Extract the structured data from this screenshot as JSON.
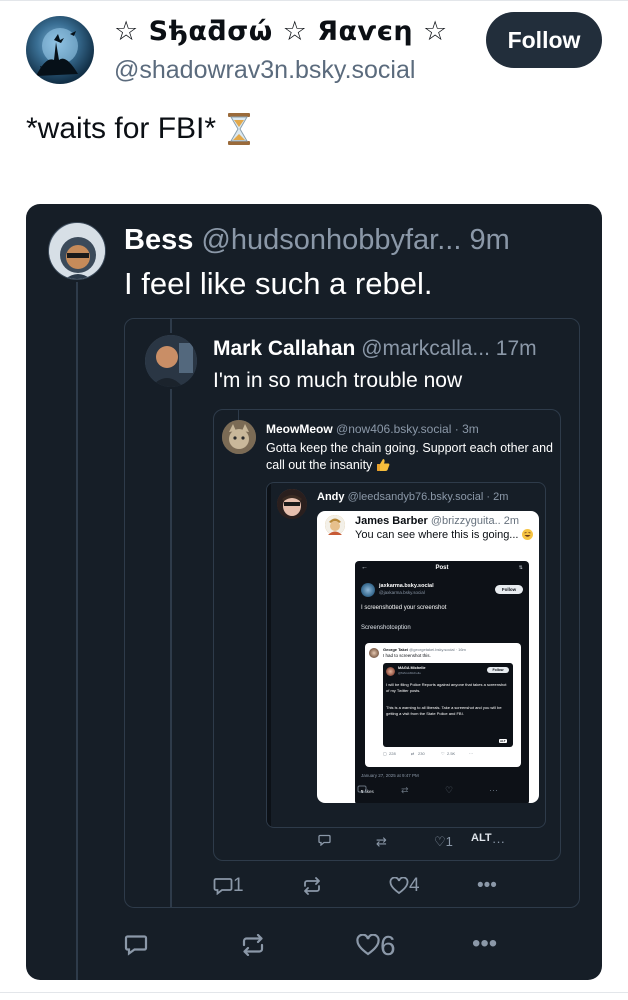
{
  "header": {
    "display_name": "☆ Sђαƌσώ ☆ Яαѵєη ☆",
    "handle": "@shadowrav3n.bsky.social",
    "follow_label": "Follow"
  },
  "post": {
    "text": "*waits for FBI*",
    "emoji": "hourglass-icon"
  },
  "quote1": {
    "name": "Bess",
    "handle": "@hudsonhobbyfar...",
    "time": "9m",
    "text": "I feel like such a rebel.",
    "replies": "",
    "likes": "6"
  },
  "quote2": {
    "name": "Mark Callahan",
    "handle": "@markcalla...",
    "time": "17m",
    "text": "I'm in so much trouble now",
    "replies": "1",
    "likes": "4"
  },
  "quote3": {
    "name": "MeowMeow",
    "handle": "@now406.bsky.social",
    "time": "3m",
    "text": "Gotta keep the chain going. Support each other and call out the insanity",
    "likes": "1",
    "alt": "ALT"
  },
  "quote4": {
    "name": "Andy",
    "handle": "@leedsandyb76.bsky.social",
    "time": "2m"
  },
  "quote5": {
    "name": "James Barber",
    "handle": "@brizzyguita..",
    "time": "2m",
    "text": "You can see where this is going..."
  },
  "screenshot": {
    "title": "Post",
    "name": "jaxkarma.bsky.social",
    "handle": "@jaxkarma.bsky.social",
    "follow": "Follow",
    "text1": "I screenshotted your screenshot",
    "text2": "Screenshotception",
    "date": "January 27, 2025 at 9:47 PM",
    "likes_count": "5",
    "likes_label": "likes"
  },
  "george": {
    "name": "George Takei",
    "handle": "@georgetakei.bsky.social",
    "time": "16m",
    "text": "I had to screenshot this.",
    "replies": "228",
    "reposts": "230",
    "likes": "2.5K"
  },
  "maga": {
    "name": "MAGA Michelle",
    "handle": "@MAGAMichelle",
    "follow": "Follow",
    "text1": "I will be filing Police Reports against anyone that takes a screenshot of my Twitter posts.",
    "text2": "This is a warning to all liberals. Take a screenshot and you will be getting a visit from the State Police and FBI.",
    "alt": "ALT"
  },
  "colors": {
    "card_bg": "#161e27",
    "border": "#2e3b4a",
    "muted": "#8b98a8",
    "follow_bg": "#222e3b"
  }
}
